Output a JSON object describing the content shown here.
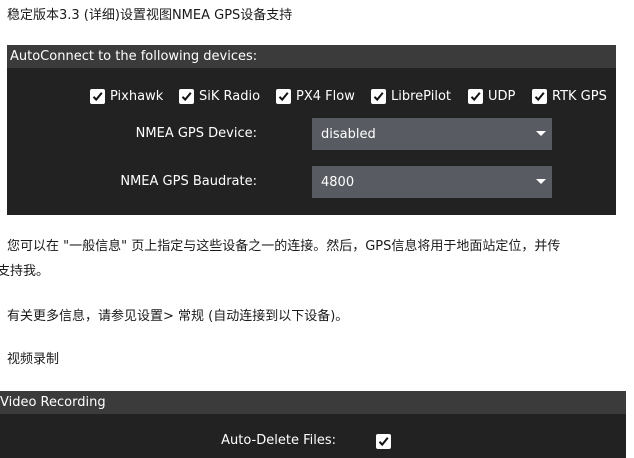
{
  "doc": {
    "heading": "稳定版本3.3 (详细)设置视图NMEA GPS设备支持",
    "para1_line1": "您可以在 \"一般信息\" 页上指定与这些设备之一的连接。然后，GPS信息将用于地面站定位，并传",
    "para1_line2": "支持我。",
    "para2": "有关更多信息，请参见设置> 常规 (自动连接到以下设备)。",
    "para3": "视频录制"
  },
  "autoconnect": {
    "title": "AutoConnect to the following devices:",
    "devices": [
      {
        "label": "Pixhawk",
        "checked": true
      },
      {
        "label": "SiK Radio",
        "checked": true
      },
      {
        "label": "PX4 Flow",
        "checked": true
      },
      {
        "label": "LibrePilot",
        "checked": true
      },
      {
        "label": "UDP",
        "checked": true
      },
      {
        "label": "RTK GPS",
        "checked": true
      }
    ],
    "nmea_device_label": "NMEA GPS Device:",
    "nmea_device_value": "disabled",
    "nmea_baud_label": "NMEA GPS Baudrate:",
    "nmea_baud_value": "4800"
  },
  "video": {
    "title": "Video Recording",
    "auto_delete_label": "Auto-Delete Files:",
    "auto_delete_checked": true
  },
  "colors": {
    "panel_bg": "#222222",
    "header_bg": "#3b3b3b",
    "combo_bg": "#585c62",
    "checkbox_bg": "#ffffff"
  }
}
